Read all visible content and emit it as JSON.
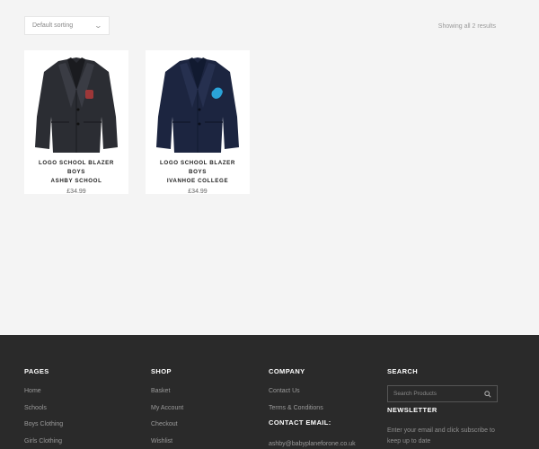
{
  "shop": {
    "sort": {
      "selected": "Default sorting",
      "icon": "chevron-down-icon"
    },
    "result_count": "Showing all 2 results",
    "products": [
      {
        "title_line1": "LOGO SCHOOL BLAZER BOYS",
        "title_line2": "ASHBY SCHOOL",
        "price": "£34.99"
      },
      {
        "title_line1": "LOGO SCHOOL BLAZER BOYS",
        "title_line2": "IVANHOE COLLEGE",
        "price": "£34.99"
      }
    ]
  },
  "footer": {
    "pages": {
      "title": "PAGES",
      "items": [
        "Home",
        "Schools",
        "Boys Clothing",
        "Girls Clothing"
      ]
    },
    "shop": {
      "title": "SHOP",
      "items": [
        "Basket",
        "My Account",
        "Checkout",
        "Wishlist"
      ]
    },
    "company": {
      "title": "COMPANY",
      "items": [
        "Contact Us",
        "Terms & Conditions"
      ],
      "contact_email_title": "CONTACT EMAIL:",
      "contact_email": "ashby@babyplaneforone.co.uk"
    },
    "search": {
      "title": "SEARCH",
      "placeholder": "Search Products",
      "icon": "search-icon"
    },
    "newsletter": {
      "title": "NEWSLETTER",
      "text": "Enter your email and click subscribe to keep up to date"
    }
  },
  "colors": {
    "background": "#f4f4f4",
    "footer": "#2a2a2a",
    "blazer_ashby": "#2b2d33",
    "blazer_ivanhoe": "#1c2540"
  }
}
